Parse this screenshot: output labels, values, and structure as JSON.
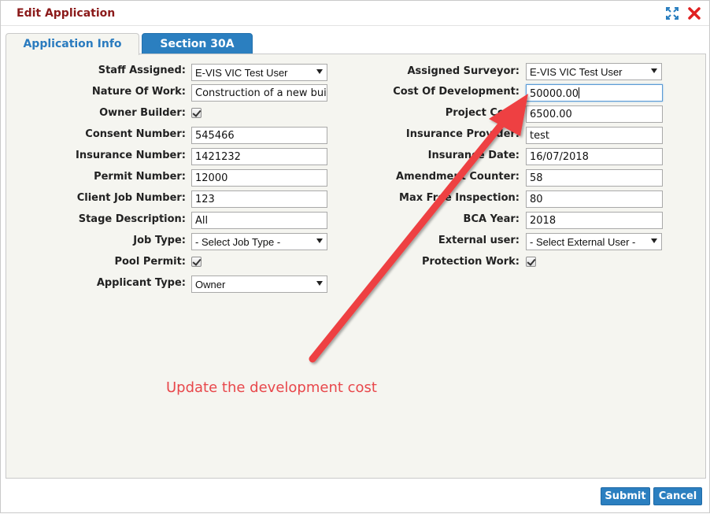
{
  "dialog": {
    "title": "Edit Application"
  },
  "tabs": [
    {
      "label": "Application Info",
      "active": true
    },
    {
      "label": "Section 30A",
      "active": false
    }
  ],
  "left": {
    "staff_assigned": {
      "label": "Staff Assigned:",
      "value": "E-VIS VIC Test User"
    },
    "nature_of_work": {
      "label": "Nature Of Work:",
      "value": "Construction of a new buil"
    },
    "owner_builder": {
      "label": "Owner Builder:",
      "checked": true
    },
    "consent_number": {
      "label": "Consent Number:",
      "value": "545466"
    },
    "insurance_number": {
      "label": "Insurance Number:",
      "value": "1421232"
    },
    "permit_number": {
      "label": "Permit Number:",
      "value": "12000"
    },
    "client_job_number": {
      "label": "Client Job Number:",
      "value": "123"
    },
    "stage_description": {
      "label": "Stage Description:",
      "value": "All"
    },
    "job_type": {
      "label": "Job Type:",
      "value": "- Select Job Type -"
    },
    "pool_permit": {
      "label": "Pool Permit:",
      "checked": true
    },
    "applicant_type": {
      "label": "Applicant Type:",
      "value": "Owner"
    }
  },
  "right": {
    "assigned_surveyor": {
      "label": "Assigned Surveyor:",
      "value": "E-VIS VIC Test User"
    },
    "cost_of_development": {
      "label": "Cost Of Development:",
      "value": "50000.00"
    },
    "project_cost": {
      "label": "Project Cost:",
      "value": "6500.00"
    },
    "insurance_provider": {
      "label": "Insurance Provider:",
      "value": "test"
    },
    "insurance_date": {
      "label": "Insurance Date:",
      "value": "16/07/2018"
    },
    "amendment_counter": {
      "label": "Amendment Counter:",
      "value": "58"
    },
    "max_free_inspection": {
      "label": "Max Free Inspection:",
      "value": "80"
    },
    "bca_year": {
      "label": "BCA Year:",
      "value": "2018"
    },
    "external_user": {
      "label": "External user:",
      "value": "- Select External User -"
    },
    "protection_work": {
      "label": "Protection Work:",
      "checked": true
    }
  },
  "annotation": {
    "text": "Update the development cost",
    "color": "#e8474b"
  },
  "buttons": {
    "submit": "Submit",
    "cancel": "Cancel"
  },
  "icons": {
    "maximize": "expand-arrows-icon",
    "close": "close-x-icon"
  },
  "colors": {
    "title": "#8b1a1a",
    "tab_active_text": "#2a7bbf",
    "button_bg": "#2b7fc0",
    "panel_bg": "#f5f5f0"
  }
}
